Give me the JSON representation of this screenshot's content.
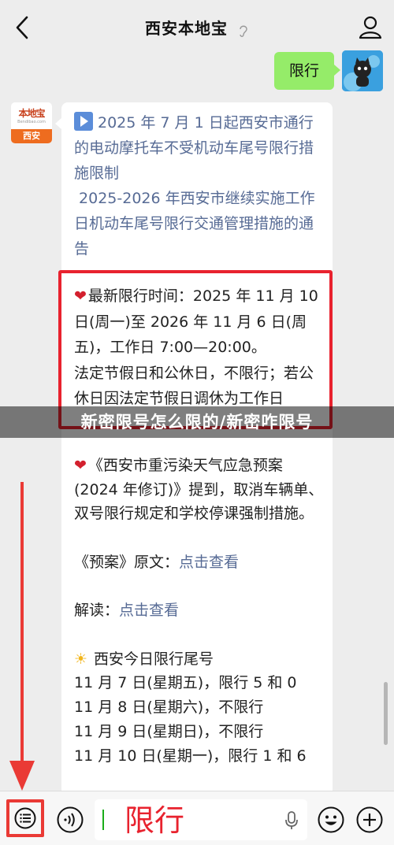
{
  "header": {
    "title": "西安本地宝"
  },
  "messages": {
    "outgoing_text": "限行",
    "bot_avatar": {
      "logo_text": "本地宝",
      "logo_url": "Bendibao.com",
      "city": "西安"
    },
    "links": [
      "2025 年 7 月 1 日起西安市通行的电动摩托车不受机动车尾号限行措施限制",
      "2025-2026 年西安市继续实施工作日机动车尾号限行交通管理措施的通告"
    ],
    "highlight": {
      "line1": "最新限行时间：2025 年 11 月 10 日(周一)至 2026 年 11 月 6 日(周五)，工作日 7:00—20:00。",
      "line2": "法定节假日和公休日，不限行；若公休日因法定节假日调休为工作日"
    },
    "overlay_title": "新密限号怎么限的/新密咋限号",
    "plan_text": "《西安市重污染天气应急预案(2024 年修订)》提到，取消车辆单、双号限行规定和学校停课强制措施。",
    "plan_label": "《预案》原文：",
    "plan_link": "点击查看",
    "interpret_label": "解读：",
    "interpret_link": "点击查看",
    "today_title": "西安今日限行尾号",
    "today_list": [
      "11 月 7 日(星期五)，限行 5 和 0",
      "11 月 8 日(星期六)，不限行",
      "11 月 9 日(星期日)，不限行",
      "11 月 10 日(星期一)，限行 1 和 6"
    ]
  },
  "input": {
    "value": "限行"
  },
  "colors": {
    "bubble_green": "#95ec69",
    "link_blue": "#576b95",
    "annotation_red": "#e8222e"
  },
  "icons": [
    "back-arrow-icon",
    "ear-icon",
    "profile-icon",
    "menu-list-icon",
    "voice-icon",
    "mic-icon",
    "emoji-icon",
    "plus-icon",
    "heart-icon",
    "sun-icon",
    "play-icon"
  ]
}
